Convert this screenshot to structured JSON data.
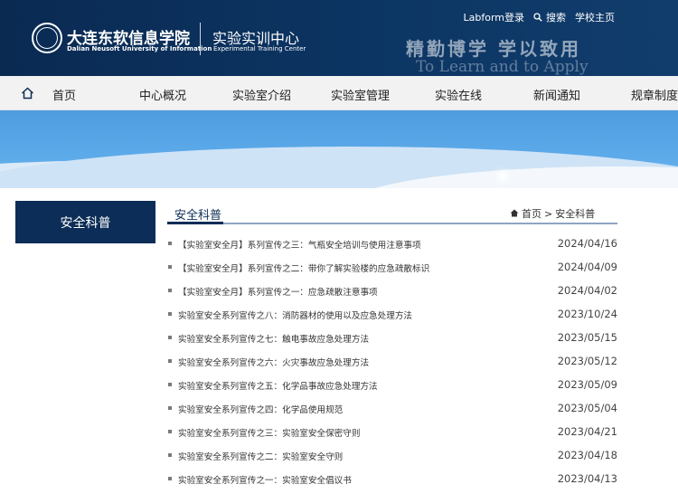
{
  "header": {
    "school_name_cn": "大连东软信息学院",
    "school_name_en": "Dalian Neusoft University of Information",
    "center_name_cn": "实验实训中心",
    "center_name_en": "Experimental Training Center",
    "slogan_cn": "精勤博学 学以致用",
    "slogan_en": "To Learn and to Apply",
    "links": {
      "login": "Labform登录",
      "search": "搜索",
      "school_home": "学校主页"
    }
  },
  "nav": {
    "items": [
      "首页",
      "中心概况",
      "实验室介绍",
      "实验室管理",
      "实验在线",
      "新闻通知",
      "规章制度"
    ]
  },
  "sidebar": {
    "title": "安全科普"
  },
  "main": {
    "title": "安全科普",
    "breadcrumb": {
      "home": "首页",
      "separator": ">",
      "current": "安全科普"
    },
    "articles": [
      {
        "title": "【实验室安全月】系列宣传之三：气瓶安全培训与使用注意事项",
        "date": "2024/04/16"
      },
      {
        "title": "【实验室安全月】系列宣传之二：带你了解实验楼的应急疏散标识",
        "date": "2024/04/09"
      },
      {
        "title": "【实验室安全月】系列宣传之一：应急疏散注意事项",
        "date": "2024/04/02"
      },
      {
        "title": "实验室安全系列宣传之八：消防器材的使用以及应急处理方法",
        "date": "2023/10/24"
      },
      {
        "title": "实验室安全系列宣传之七：触电事故应急处理方法",
        "date": "2023/05/15"
      },
      {
        "title": "实验室安全系列宣传之六：火灾事故应急处理方法",
        "date": "2023/05/12"
      },
      {
        "title": "实验室安全系列宣传之五：化学品事故应急处理方法",
        "date": "2023/05/09"
      },
      {
        "title": "实验室安全系列宣传之四：化学品使用规范",
        "date": "2023/05/04"
      },
      {
        "title": "实验室安全系列宣传之三：实验室安全保密守则",
        "date": "2023/04/21"
      },
      {
        "title": "实验室安全系列宣传之二：实验室安全守则",
        "date": "2023/04/18"
      },
      {
        "title": "实验室安全系列宣传之一：实验室安全倡议书",
        "date": "2023/04/13"
      }
    ]
  },
  "colors": {
    "header_bg": "#0a2a52",
    "accent_navy": "#0c2d57",
    "banner_blue": "#5aa8e8"
  }
}
